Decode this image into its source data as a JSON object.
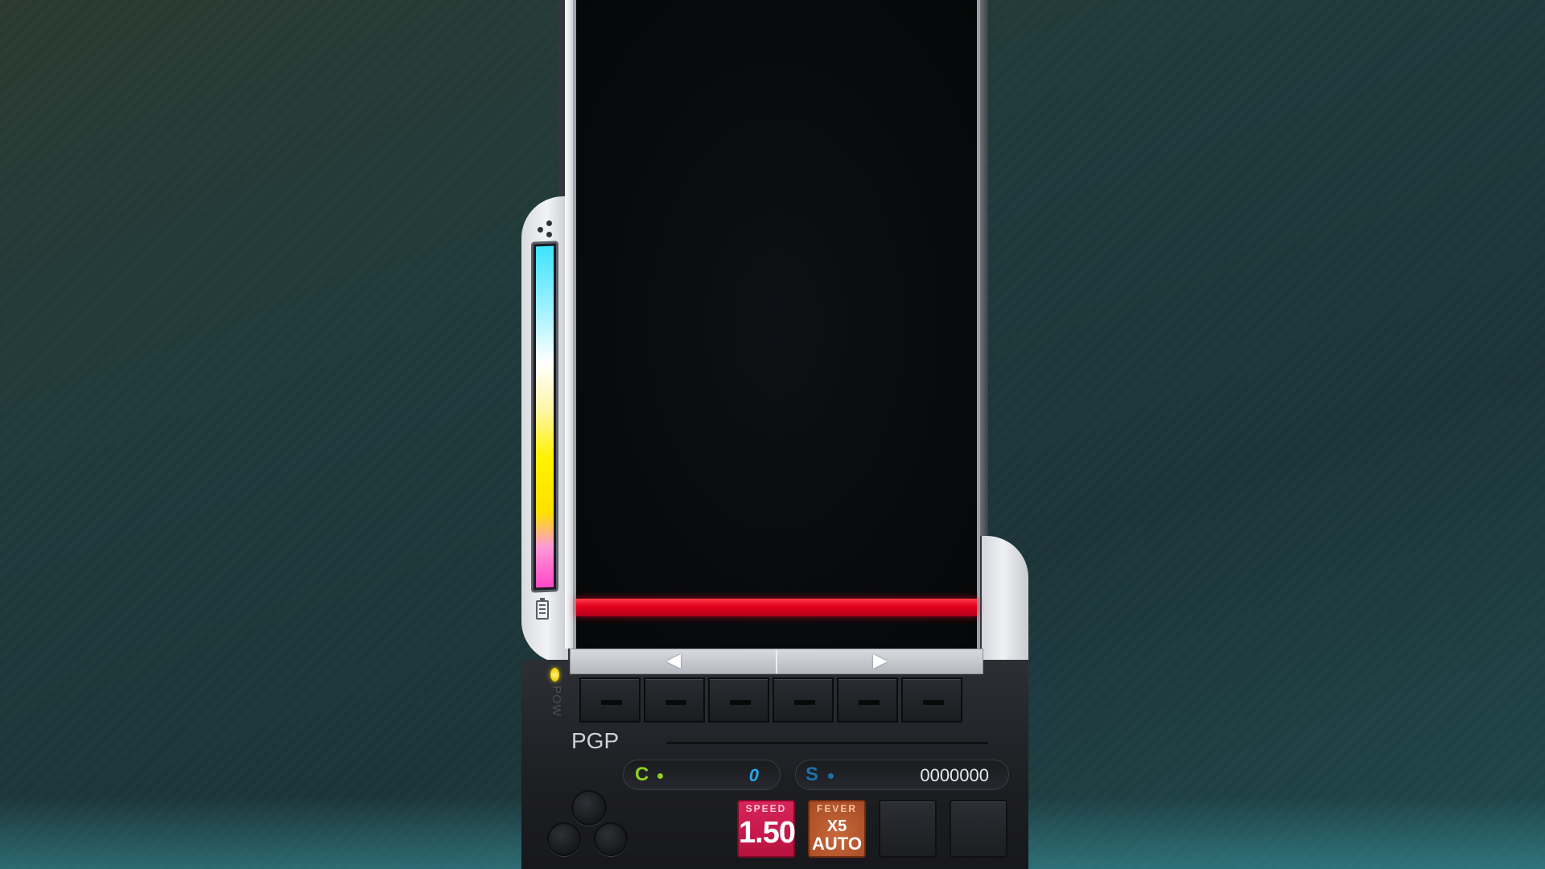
{
  "hud": {
    "player": "PGP",
    "pow_label": "POW",
    "combo": {
      "letter": "C",
      "value": "0"
    },
    "score": {
      "letter": "S",
      "value": "0000000"
    }
  },
  "items": {
    "speed": {
      "title": "SPEED",
      "value": "1.50"
    },
    "fever": {
      "title": "FEVER",
      "multiplier": "X5",
      "mode": "AUTO"
    }
  },
  "gauge": {
    "level": 0.95
  },
  "colors": {
    "judge_line": "#e1001c",
    "combo_accent": "#8fcf1f",
    "score_accent": "#1e6fa8",
    "speed_tile": "#d8245a",
    "fever_tile": "#c9673a"
  }
}
